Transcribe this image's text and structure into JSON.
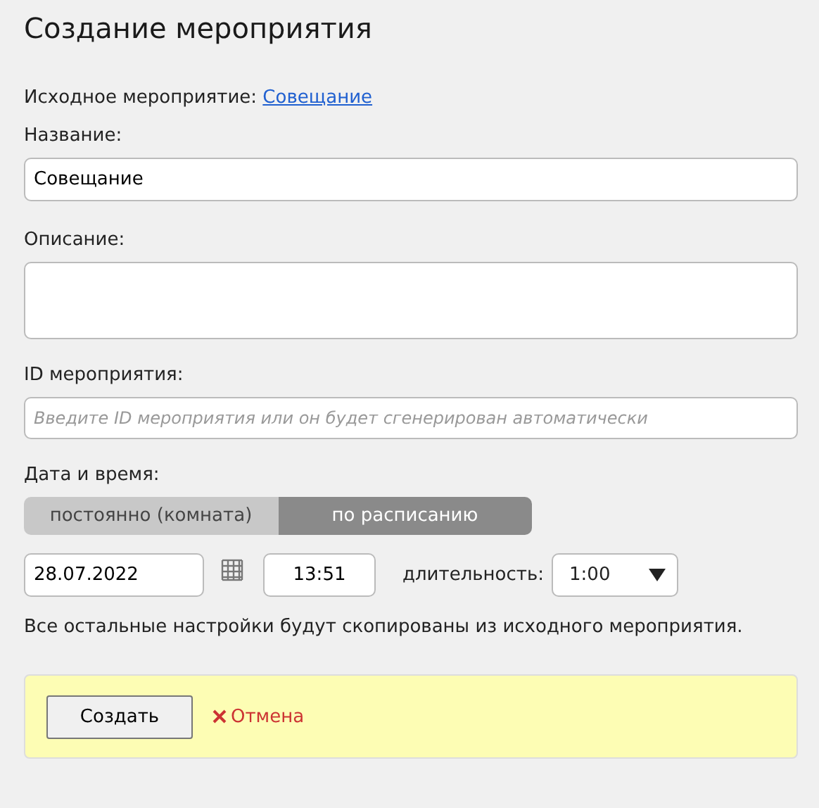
{
  "title": "Создание мероприятия",
  "source": {
    "label": "Исходное мероприятие:",
    "link": "Совещание"
  },
  "name_field": {
    "label": "Название:",
    "value": "Совещание"
  },
  "description_field": {
    "label": "Описание:"
  },
  "id_field": {
    "label": "ID мероприятия:",
    "placeholder": "Введите ID мероприятия или он будет сгенерирован автоматически"
  },
  "datetime": {
    "label": "Дата и время:",
    "modes": [
      {
        "label": "постоянно (комната)",
        "selected": false
      },
      {
        "label": "по расписанию",
        "selected": true
      }
    ],
    "date": "28.07.2022",
    "time": "13:51",
    "duration_label": "длительность:",
    "duration": "1:00"
  },
  "note": "Все остальные настройки будут скопированы из исходного мероприятия.",
  "actions": {
    "create": "Создать",
    "cancel": "Отмена"
  }
}
